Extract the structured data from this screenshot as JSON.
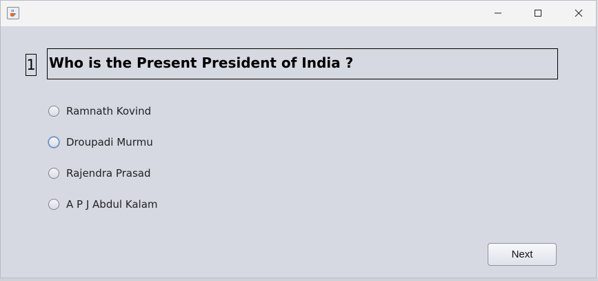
{
  "window": {
    "icon": "java-cup-icon",
    "controls": [
      "minimize-icon",
      "maximize-icon",
      "close-icon"
    ]
  },
  "question": {
    "number": "1",
    "text": "Who is the Present President of India ?"
  },
  "options": [
    {
      "label": "Ramnath Kovind",
      "selected": false,
      "focused": false
    },
    {
      "label": "Droupadi Murmu",
      "selected": false,
      "focused": true
    },
    {
      "label": "Rajendra Prasad",
      "selected": false,
      "focused": false
    },
    {
      "label": "A P J Abdul Kalam",
      "selected": false,
      "focused": false
    }
  ],
  "actions": {
    "next_label": "Next"
  }
}
